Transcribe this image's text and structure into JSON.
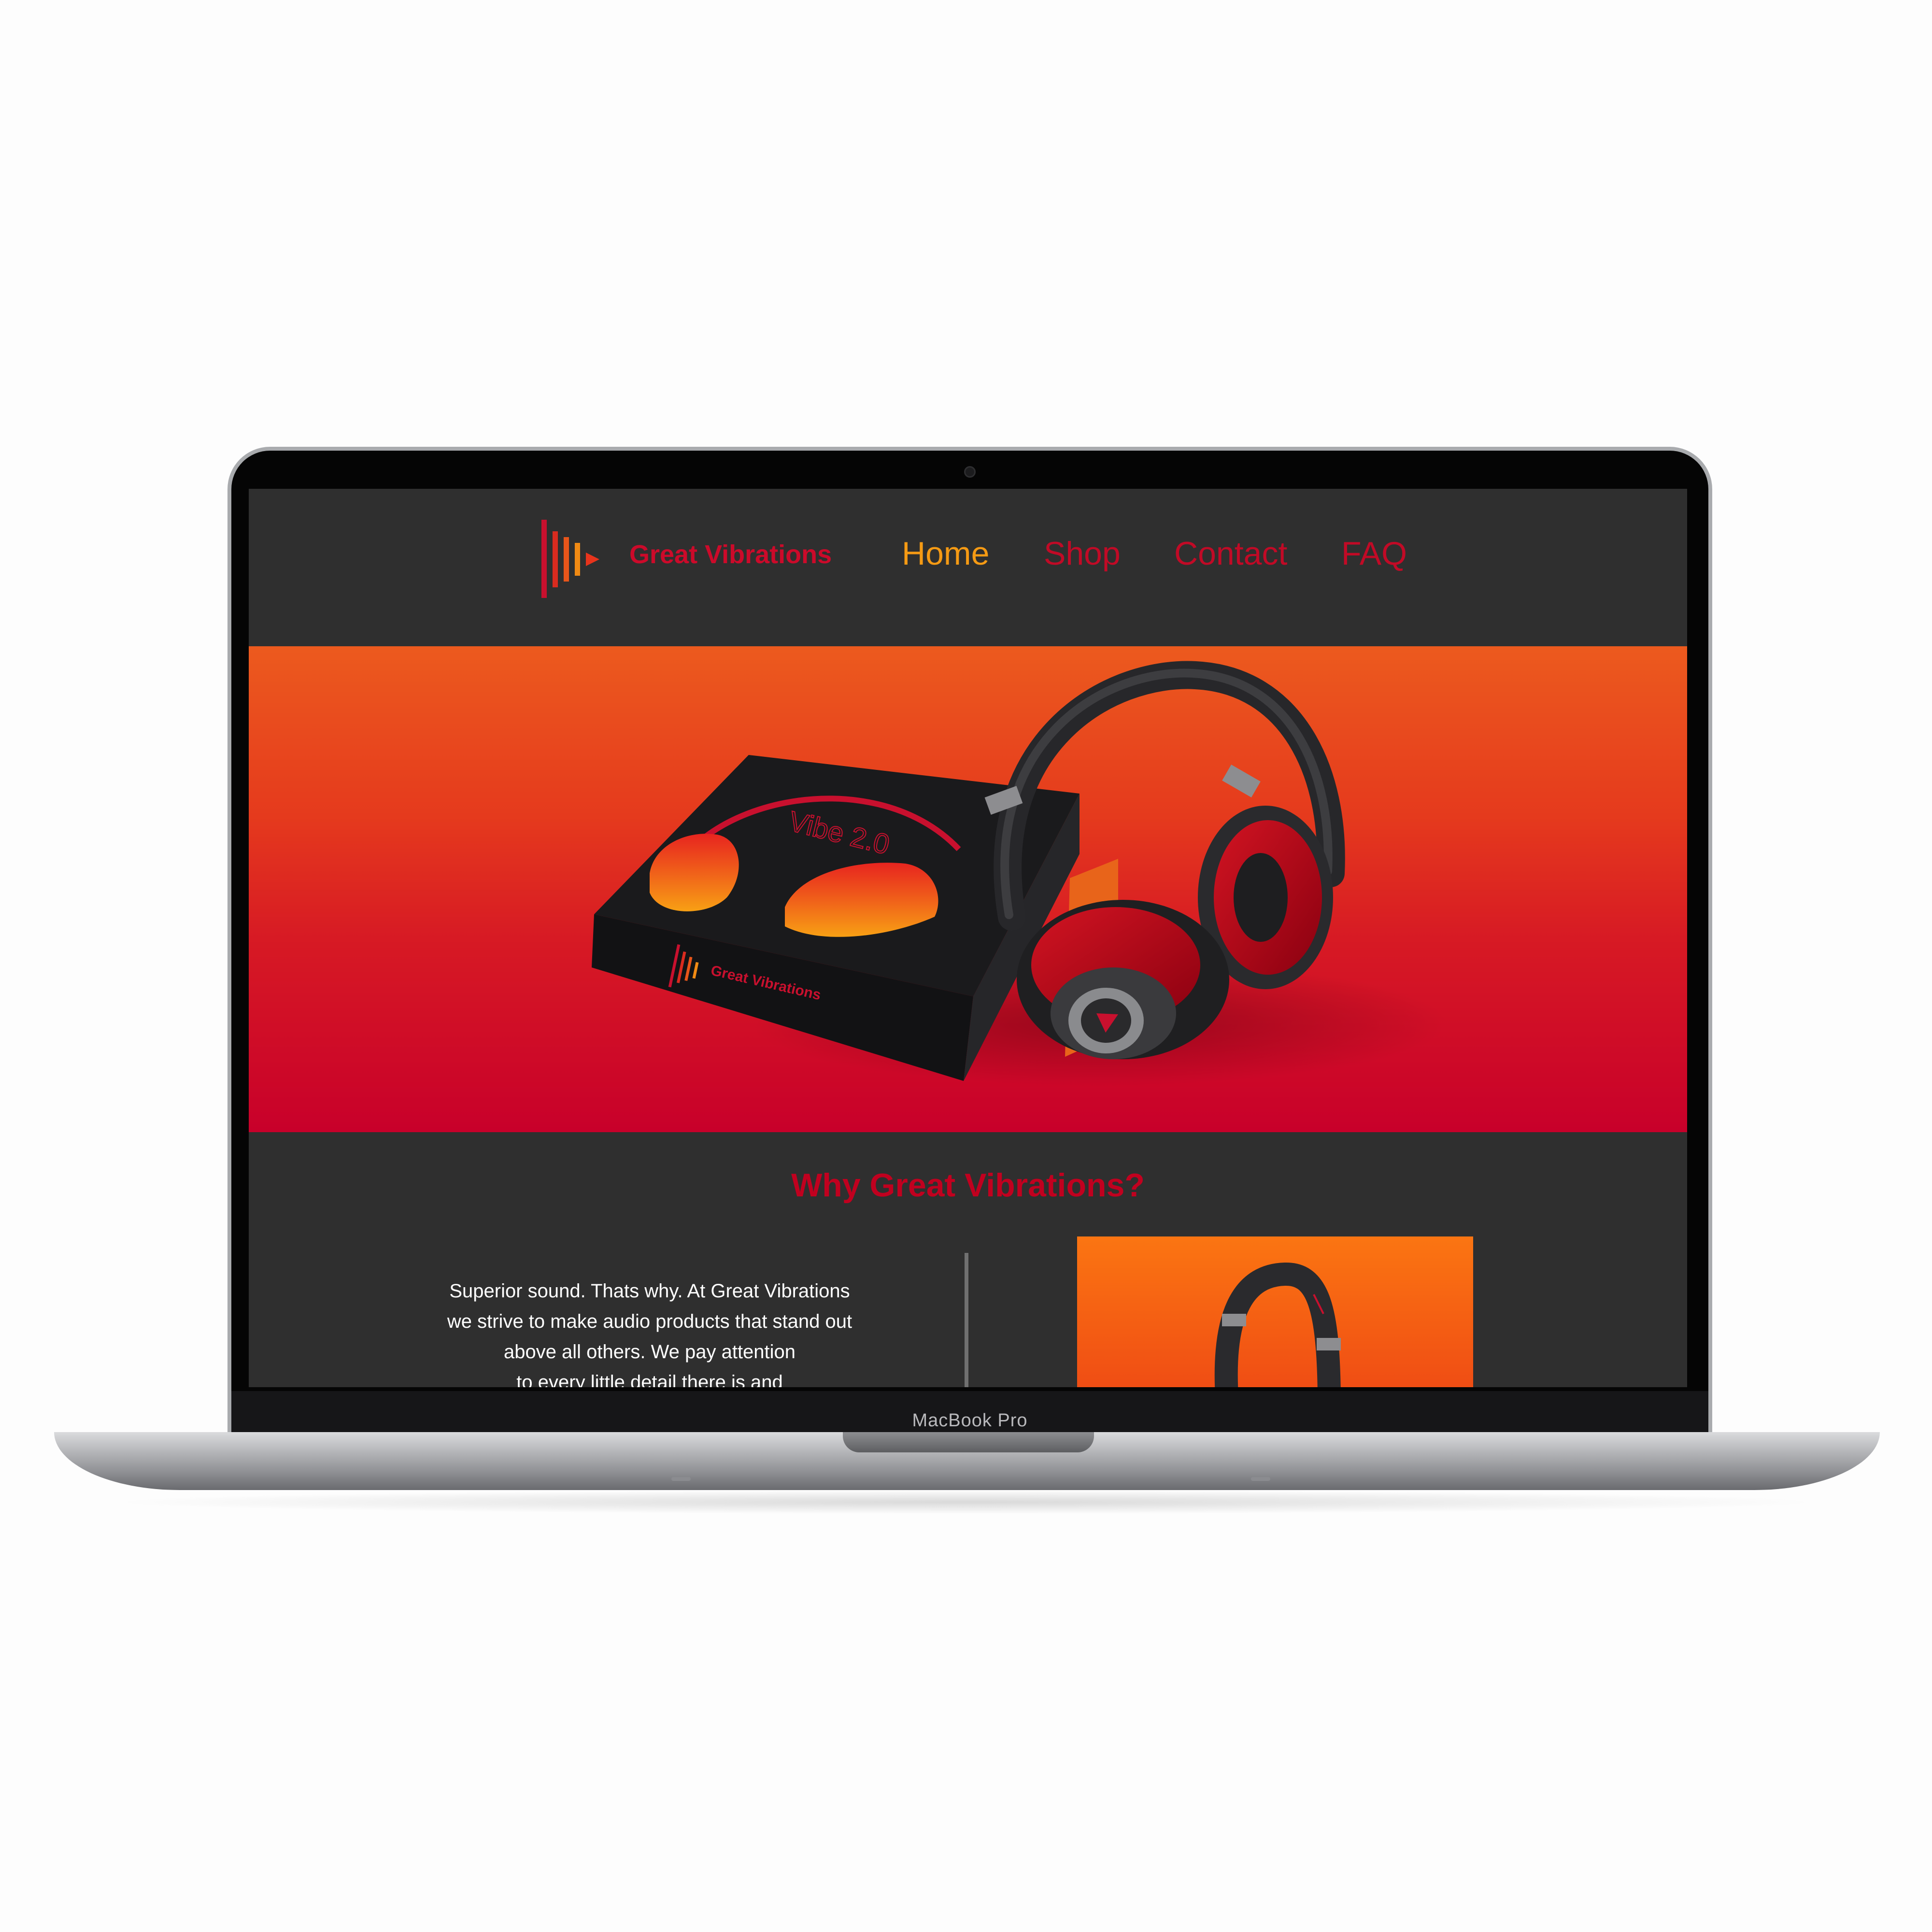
{
  "device": {
    "label": "MacBook Pro"
  },
  "brand": {
    "name": "Great Vibrations"
  },
  "nav": [
    {
      "label": "Home",
      "active": true
    },
    {
      "label": "Shop",
      "active": false
    },
    {
      "label": "Contact",
      "active": false
    },
    {
      "label": "FAQ",
      "active": false
    }
  ],
  "hero": {
    "box_title": "Vibe 2.0",
    "box_brand": "Great Vibrations"
  },
  "why": {
    "title": "Why Great Vibrations?",
    "lines": [
      "Superior sound. Thats why. At Great Vibrations",
      "we strive to make audio products that stand out",
      "above all others. We pay attention",
      "to every little detail there is and"
    ]
  },
  "colors": {
    "brand_red": "#cc0a2a",
    "nav_active": "#f59a14",
    "page_bg": "#2f2f2f",
    "hero_top": "#ec5a1e",
    "hero_bottom": "#c8002a"
  }
}
